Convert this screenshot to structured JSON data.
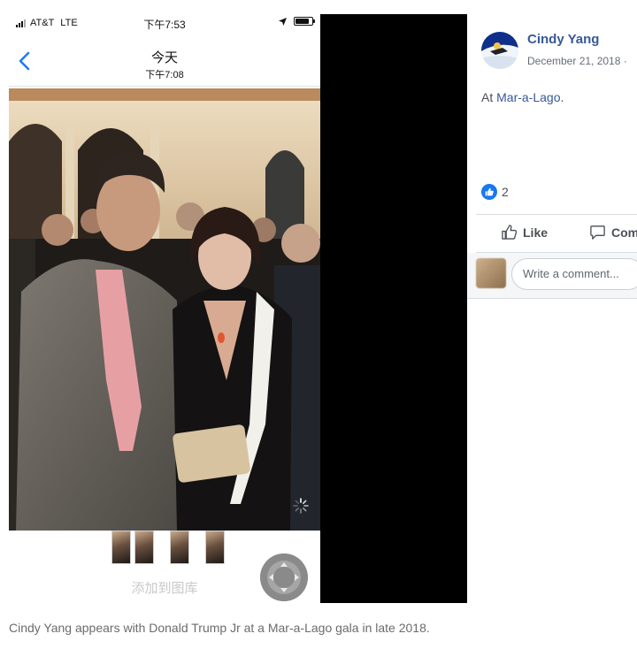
{
  "phone": {
    "status_bar": {
      "carrier": "AT&T",
      "network": "LTE",
      "time": "下午7:53"
    },
    "header": {
      "title": "今天",
      "subtitle": "下午7:08"
    },
    "save_label": "添加到图库"
  },
  "facebook_post": {
    "author": "Cindy Yang",
    "date": "December 21, 2018 · ",
    "text_prefix": "At ",
    "location_link": "Mar-a-Lago",
    "text_suffix": ".",
    "reaction_count": "2",
    "like_label": "Like",
    "comment_label": "Comment",
    "comment_placeholder": "Write a comment..."
  },
  "caption": "Cindy Yang appears with Donald Trump Jr at a Mar-a-Lago gala in late 2018.",
  "colors": {
    "facebook_blue": "#385898",
    "like_badge": "#1877f2",
    "panel_black": "#000000"
  },
  "icons": [
    "signal-bars-icon",
    "location-arrow-icon",
    "battery-icon",
    "back-chevron-icon",
    "assistive-touch-icon",
    "like-badge-icon",
    "thumbs-up-icon",
    "comment-bubble-icon"
  ]
}
